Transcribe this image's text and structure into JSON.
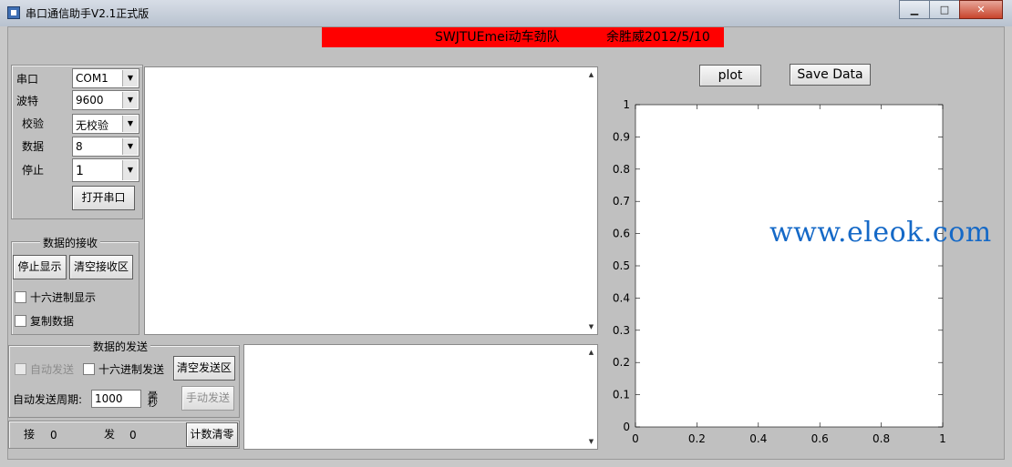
{
  "window": {
    "title": "串口通信助手V2.1正式版",
    "buttons": {
      "minimize": "▁",
      "maximize": "□",
      "close": "✕"
    }
  },
  "banner": {
    "team": "SWJTUEmei动车劲队",
    "author_date": "余胜威2012/5/10",
    "color": "#ff0000"
  },
  "serial_settings": {
    "port_label": "串口",
    "port_value": "COM1",
    "baud_label": "波特",
    "baud_value": "9600",
    "parity_label": "校验",
    "parity_value": "无校验",
    "data_label": "数据",
    "data_value": "8",
    "stop_label": "停止",
    "stop_value": "1",
    "open_button": "打开串口"
  },
  "receive": {
    "group_title": "数据的接收",
    "stop_display": "停止显示",
    "clear_receive": "清空接收区",
    "hex_display": "十六进制显示",
    "copy_data": "复制数据"
  },
  "send": {
    "group_title": "数据的发送",
    "auto_send": "自动发送",
    "hex_send": "十六进制发送",
    "clear_send": "清空发送区",
    "period_label": "自动发送周期:",
    "period_value": "1000",
    "period_unit": "毫秒",
    "manual_send": "手动发送"
  },
  "counters": {
    "rx_label": "接收",
    "rx_value": "0",
    "tx_label": "发送",
    "tx_value": "0",
    "reset_button": "计数清零"
  },
  "plot_controls": {
    "plot_button": "plot",
    "save_button": "Save Data"
  },
  "chart_data": {
    "type": "line",
    "series": [],
    "xlim": [
      0,
      1
    ],
    "ylim": [
      0,
      1
    ],
    "x_ticks": [
      "0",
      "0.2",
      "0.4",
      "0.6",
      "0.8",
      "1"
    ],
    "y_ticks": [
      "0",
      "0.1",
      "0.2",
      "0.3",
      "0.4",
      "0.5",
      "0.6",
      "0.7",
      "0.8",
      "0.9",
      "1"
    ],
    "grid": false
  },
  "watermark": "www.eleok.com"
}
